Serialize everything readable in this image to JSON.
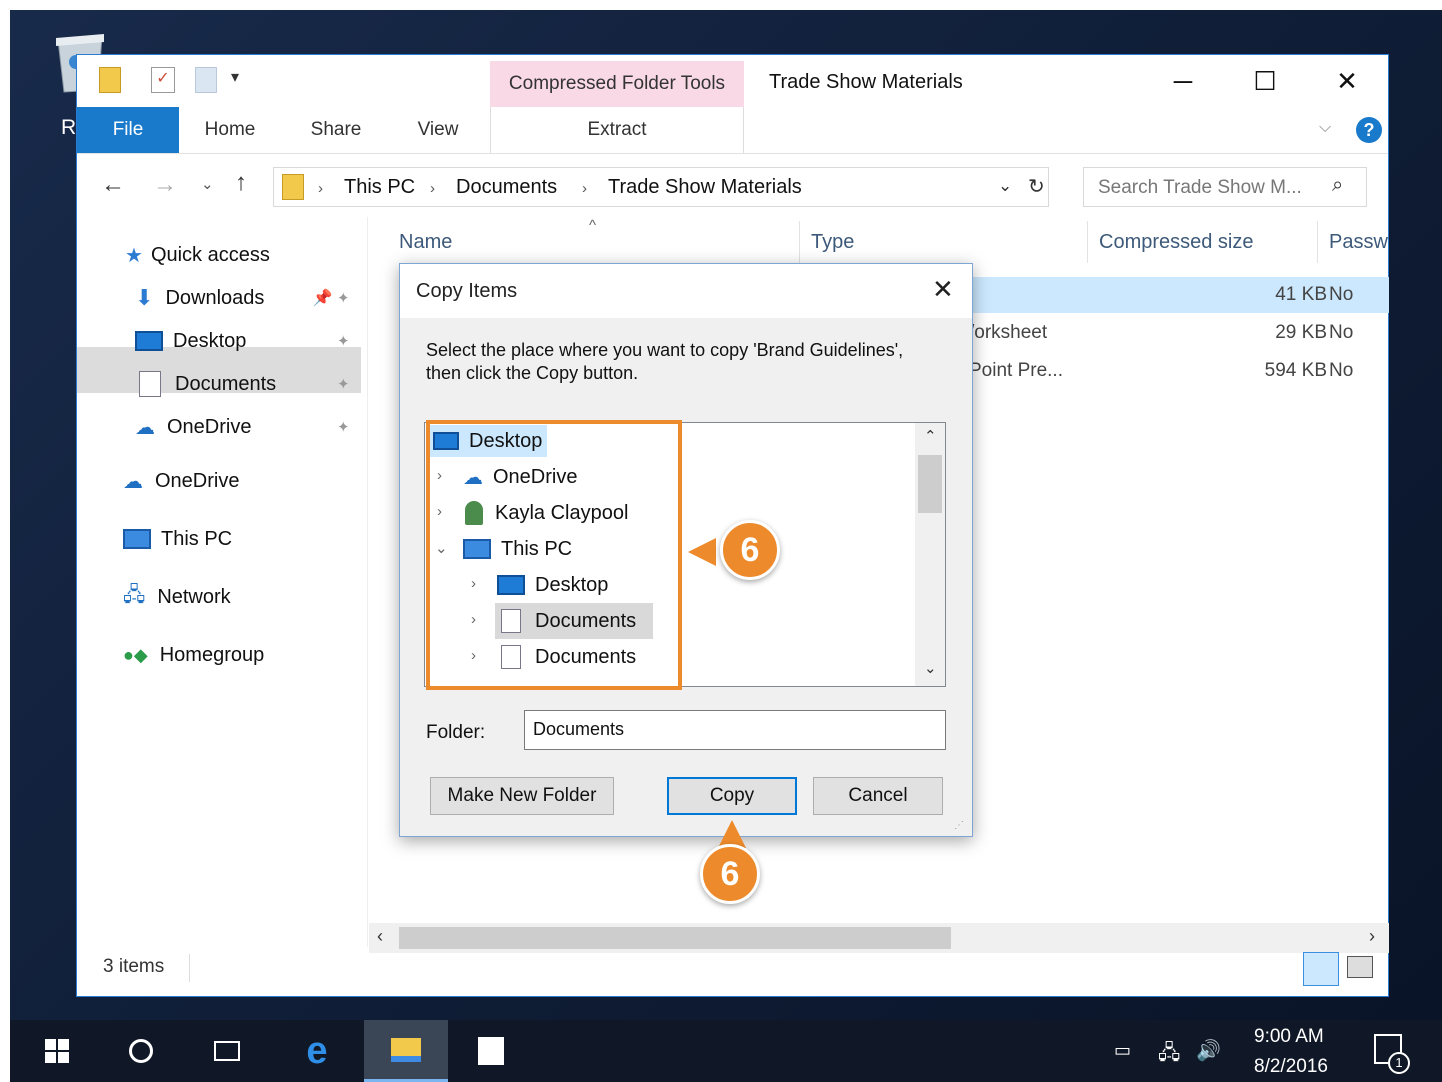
{
  "window": {
    "title": "Trade Show Materials",
    "context_tab": "Compressed Folder Tools",
    "context_sub_tab": "Extract",
    "tabs": [
      "File",
      "Home",
      "Share",
      "View"
    ],
    "controls": {
      "minimize": "─",
      "maximize": "☐",
      "close": "✕"
    }
  },
  "desktop": {
    "recycle_label": "Recycle Bin"
  },
  "address": {
    "breadcrumbs": [
      "This PC",
      "Documents",
      "Trade Show Materials"
    ],
    "search_placeholder": "Search Trade Show M..."
  },
  "sidebar": {
    "quick_access": "Quick access",
    "items": [
      {
        "label": "Downloads",
        "icon": "downloads-icon"
      },
      {
        "label": "Desktop",
        "icon": "desktop-icon"
      },
      {
        "label": "Documents",
        "icon": "documents-icon"
      },
      {
        "label": "OneDrive",
        "icon": "onedrive-icon"
      }
    ],
    "roots": [
      {
        "label": "OneDrive",
        "icon": "onedrive-icon"
      },
      {
        "label": "This PC",
        "icon": "this-pc-icon"
      },
      {
        "label": "Network",
        "icon": "network-icon"
      },
      {
        "label": "Homegroup",
        "icon": "homegroup-icon"
      }
    ]
  },
  "file_list": {
    "columns": [
      "Name",
      "Type",
      "Compressed size",
      "Passw"
    ],
    "rows": [
      {
        "type": "",
        "size": "41 KB",
        "password": "No"
      },
      {
        "type": "/orksheet",
        "size": "29 KB",
        "password": "No"
      },
      {
        "type": "Point Pre...",
        "size": "594 KB",
        "password": "No"
      }
    ]
  },
  "status": {
    "items": "3 items"
  },
  "dialog": {
    "title": "Copy Items",
    "instruction_1": "Select the place where you want to copy 'Brand Guidelines',",
    "instruction_2": "then click the Copy button.",
    "tree": [
      {
        "label": "Desktop",
        "level": 0
      },
      {
        "label": "OneDrive",
        "level": 1
      },
      {
        "label": "Kayla Claypool",
        "level": 1
      },
      {
        "label": "This PC",
        "level": 1
      },
      {
        "label": "Desktop",
        "level": 2
      },
      {
        "label": "Documents",
        "level": 2
      },
      {
        "label": "Documents",
        "level": 2
      }
    ],
    "folder_label": "Folder:",
    "folder_value": "Documents",
    "make_new_folder": "Make New Folder",
    "copy": "Copy",
    "cancel": "Cancel"
  },
  "callouts": {
    "tree": "6",
    "copy": "6"
  },
  "taskbar": {
    "time": "9:00 AM",
    "date": "8/2/2016",
    "notification_count": "1"
  },
  "colors": {
    "accent": "#1979ca",
    "callout": "#ec8a2c",
    "selection": "#cce8ff"
  }
}
